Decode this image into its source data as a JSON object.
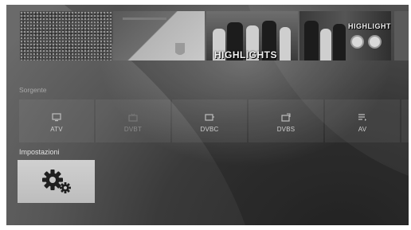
{
  "thumbnails": [
    {
      "name": "crowd"
    },
    {
      "name": "team-crest"
    },
    {
      "name": "highlights-1",
      "caption": "HIGHLIGHTS"
    },
    {
      "name": "players"
    },
    {
      "name": "highlights-2",
      "caption": "HIGHLIGHTS"
    },
    {
      "name": "partial"
    }
  ],
  "sources": {
    "title": "Sorgente",
    "items": [
      {
        "label": "ATV",
        "icon": "monitor-icon",
        "selected": false
      },
      {
        "label": "DVBT",
        "icon": "antenna-icon",
        "selected": false
      },
      {
        "label": "DVBC",
        "icon": "cable-icon",
        "selected": false
      },
      {
        "label": "DVBS",
        "icon": "satellite-icon",
        "selected": false
      },
      {
        "label": "AV",
        "icon": "av-input-icon",
        "selected": false
      }
    ]
  },
  "settings": {
    "title": "Impostazioni",
    "icon": "gear-icon",
    "focused": true
  }
}
